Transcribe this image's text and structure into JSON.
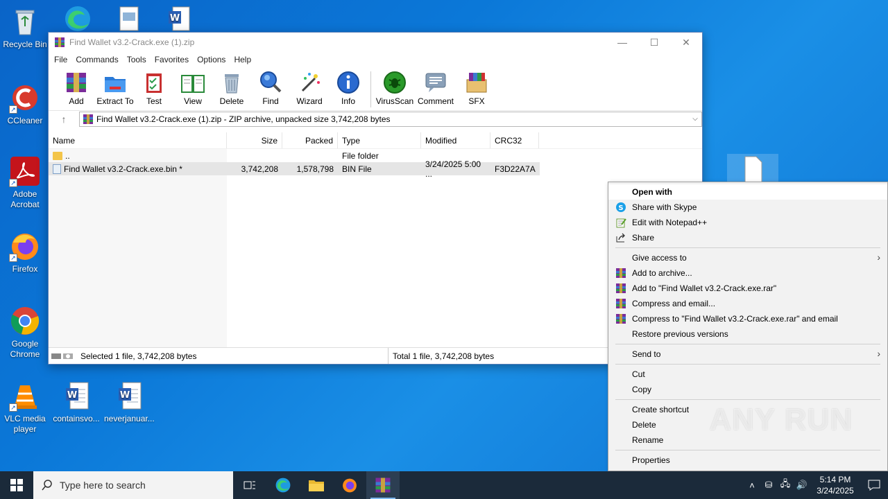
{
  "desktop": {
    "icons": [
      {
        "label": "Recycle Bin"
      },
      {
        "label": "CCleaner"
      },
      {
        "label": "Adobe\nAcrobat"
      },
      {
        "label": "Firefox"
      },
      {
        "label": "Google\nChrome"
      },
      {
        "label": "VLC media\nplayer"
      },
      {
        "label": "containsvo..."
      },
      {
        "label": "neverjanuar..."
      }
    ]
  },
  "window": {
    "title": "Find Wallet v3.2-Crack.exe (1).zip",
    "controls": {
      "minimize": "—",
      "maximize": "☐",
      "close": "✕"
    },
    "menu": [
      "File",
      "Commands",
      "Tools",
      "Favorites",
      "Options",
      "Help"
    ],
    "toolbar": [
      {
        "label": "Add",
        "icon": "add-archive-icon"
      },
      {
        "label": "Extract To",
        "icon": "extract-folder-icon"
      },
      {
        "label": "Test",
        "icon": "test-clipboard-icon"
      },
      {
        "label": "View",
        "icon": "view-book-icon"
      },
      {
        "label": "Delete",
        "icon": "trash-icon"
      },
      {
        "label": "Find",
        "icon": "magnifier-icon"
      },
      {
        "label": "Wizard",
        "icon": "wand-icon"
      },
      {
        "label": "Info",
        "icon": "info-icon"
      },
      {
        "label": "VirusScan",
        "icon": "virus-scan-icon"
      },
      {
        "label": "Comment",
        "icon": "comment-icon"
      },
      {
        "label": "SFX",
        "icon": "sfx-box-icon"
      }
    ],
    "address": "Find Wallet v3.2-Crack.exe (1).zip - ZIP archive, unpacked size 3,742,208 bytes",
    "columns": {
      "name": "Name",
      "size": "Size",
      "packed": "Packed",
      "type": "Type",
      "modified": "Modified",
      "crc": "CRC32"
    },
    "rows": [
      {
        "name": "..",
        "size": "",
        "packed": "",
        "type": "File folder",
        "modified": "",
        "crc": ""
      },
      {
        "name": "Find Wallet v3.2-Crack.exe.bin *",
        "size": "3,742,208",
        "packed": "1,578,798",
        "type": "BIN File",
        "modified": "3/24/2025 5:00 ...",
        "crc": "F3D22A7A"
      }
    ],
    "status": {
      "left": "Selected 1 file, 3,742,208 bytes",
      "right": "Total 1 file, 3,742,208 bytes"
    }
  },
  "context_menu": {
    "open_with": "Open with",
    "share_skype": "Share with Skype",
    "edit_notepad": "Edit with Notepad++",
    "share": "Share",
    "give_access": "Give access to",
    "add_archive": "Add to archive...",
    "add_rar": "Add to \"Find Wallet v3.2-Crack.exe.rar\"",
    "compress_email": "Compress and email...",
    "compress_rar_email": "Compress to \"Find Wallet v3.2-Crack.exe.rar\" and email",
    "restore": "Restore previous versions",
    "send_to": "Send to",
    "cut": "Cut",
    "copy": "Copy",
    "create_shortcut": "Create shortcut",
    "delete": "Delete",
    "rename": "Rename",
    "properties": "Properties"
  },
  "watermark": "ANY RUN",
  "taskbar": {
    "search_placeholder": "Type here to search",
    "time": "5:14 PM",
    "date": "3/24/2025"
  }
}
